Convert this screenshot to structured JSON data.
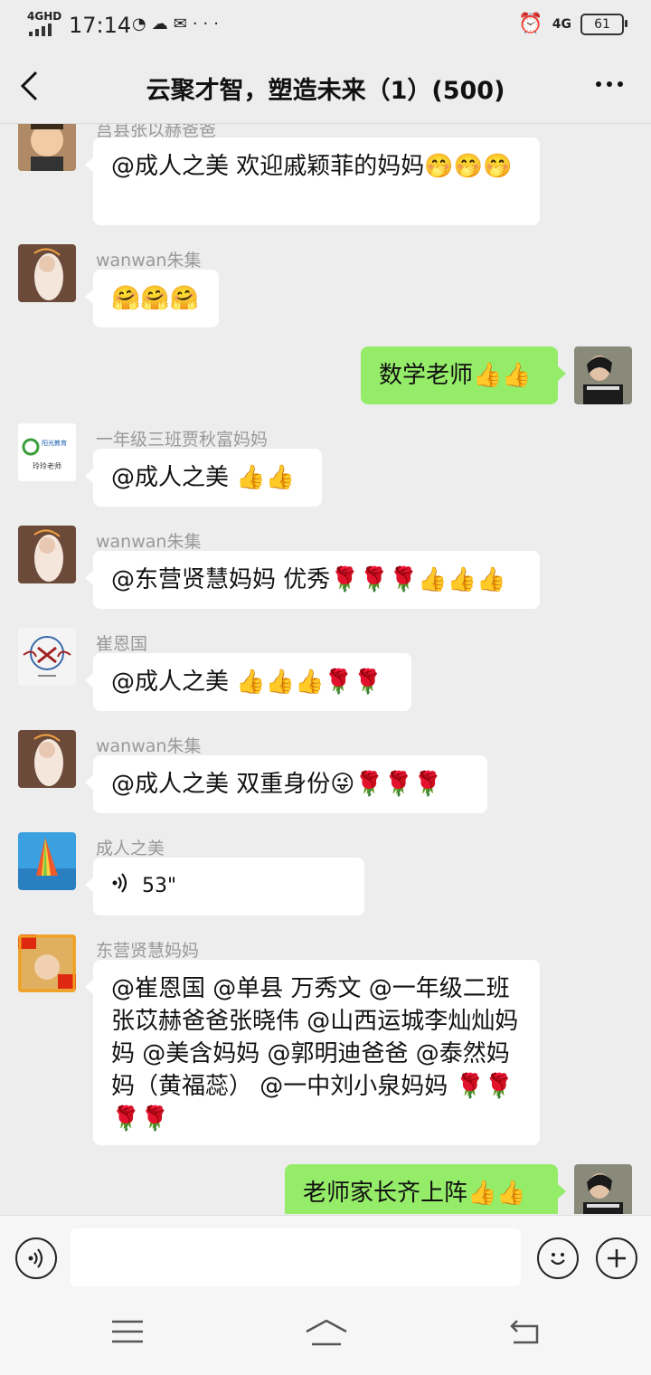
{
  "status_bar": {
    "network": "4GHD",
    "time": "17:14",
    "icons": [
      "wechat-icon",
      "cloud-icon",
      "message-icon",
      "more-dots"
    ],
    "right_network": "4G",
    "battery": "61"
  },
  "header": {
    "title": "云聚才智，塑造未来（1）(500)"
  },
  "messages": [
    {
      "name": "莒县张以赫爸爸",
      "text": "@成人之美 欢迎戚颖菲的妈妈🤭🤭🤭"
    },
    {
      "name": "wanwan朱集",
      "text": "🤗🤗🤗"
    },
    {
      "name": "",
      "text": "数学老师👍👍"
    },
    {
      "name": "一年级三班贾秋富妈妈",
      "text": "@成人之美 👍👍"
    },
    {
      "name": "wanwan朱集",
      "text": "@东营贤慧妈妈 优秀🌹🌹🌹👍👍👍"
    },
    {
      "name": "崔恩国",
      "text": "@成人之美 👍👍👍🌹🌹"
    },
    {
      "name": "wanwan朱集",
      "text": "@成人之美 双重身份😜🌹🌹🌹"
    },
    {
      "name": "成人之美",
      "text": "53\""
    },
    {
      "name": "东营贤慧妈妈",
      "text": "@崔恩国 @单县  万秀文 @一年级二班张苡赫爸爸张晓伟 @山西运城李灿灿妈妈 @美含妈妈 @郭明迪爸爸 @泰然妈妈（黄福蕊） @一中刘小泉妈妈 🌹🌹🌹🌹"
    },
    {
      "name": "",
      "text": "老师家长齐上阵👍👍"
    }
  ],
  "avatar_texts": {
    "yangguang": "阳光教育",
    "lingling": "玲玲老师"
  },
  "input": {
    "placeholder": ""
  },
  "colors": {
    "background": "#ededed",
    "own_bubble": "#95ec69",
    "other_bubble": "#ffffff"
  }
}
